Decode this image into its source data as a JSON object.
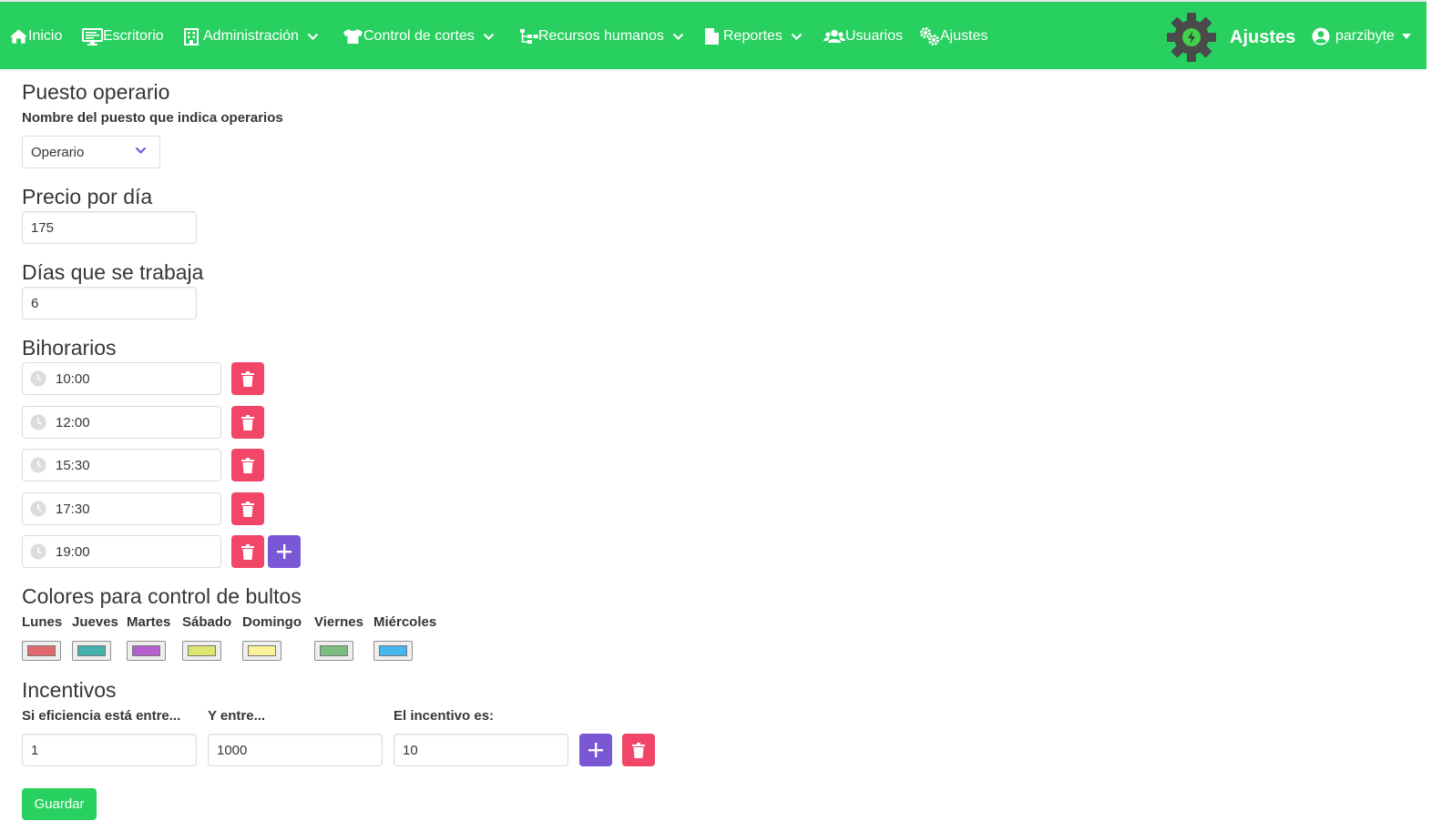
{
  "nav": {
    "items": [
      {
        "label": "Inicio",
        "icon": "home-icon"
      },
      {
        "label": "Escritorio",
        "icon": "desktop-icon"
      },
      {
        "label": "Administración",
        "icon": "building-icon",
        "dropdown": true
      },
      {
        "label": "Control de cortes",
        "icon": "shirt-icon",
        "dropdown": true
      },
      {
        "label": "Recursos humanos",
        "icon": "sitemap-icon",
        "dropdown": true
      },
      {
        "label": "Reportes",
        "icon": "file-icon",
        "dropdown": true
      },
      {
        "label": "Usuarios",
        "icon": "users-icon"
      },
      {
        "label": "Ajustes",
        "icon": "cogs-icon"
      }
    ],
    "brand_title": "Ajustes",
    "user_name": "parzibyte",
    "bar_color": "#28d05f"
  },
  "puesto": {
    "title": "Puesto operario",
    "label": "Nombre del puesto que indica operarios",
    "selected": "Operario"
  },
  "precio": {
    "title": "Precio por día",
    "value": "175"
  },
  "dias": {
    "title": "Días que se trabaja",
    "value": "6"
  },
  "bihorarios": {
    "title": "Bihorarios",
    "times": [
      "10:00",
      "12:00",
      "15:30",
      "17:30",
      "19:00"
    ]
  },
  "colores": {
    "title": "Colores para control de bultos",
    "days": [
      {
        "label": "Lunes",
        "color": "#e06a6f"
      },
      {
        "label": "Jueves",
        "color": "#45b3ad"
      },
      {
        "label": "Martes",
        "color": "#b660cd"
      },
      {
        "label": "Sábado",
        "color": "#dde46f"
      },
      {
        "label": "Domingo",
        "color": "#fbf29b"
      },
      {
        "label": "Viernes",
        "color": "#7cbd80"
      },
      {
        "label": "Miércoles",
        "color": "#45b5ee"
      }
    ]
  },
  "incentivos": {
    "title": "Incentivos",
    "label_min": "Si eficiencia está entre...",
    "label_max": "Y entre...",
    "label_value": "El incentivo es:",
    "min": "1",
    "max": "1000",
    "value": "10"
  },
  "save_label": "Guardar",
  "colors": {
    "danger": "#f14668",
    "primary": "#7957d5",
    "success": "#28d05f"
  }
}
